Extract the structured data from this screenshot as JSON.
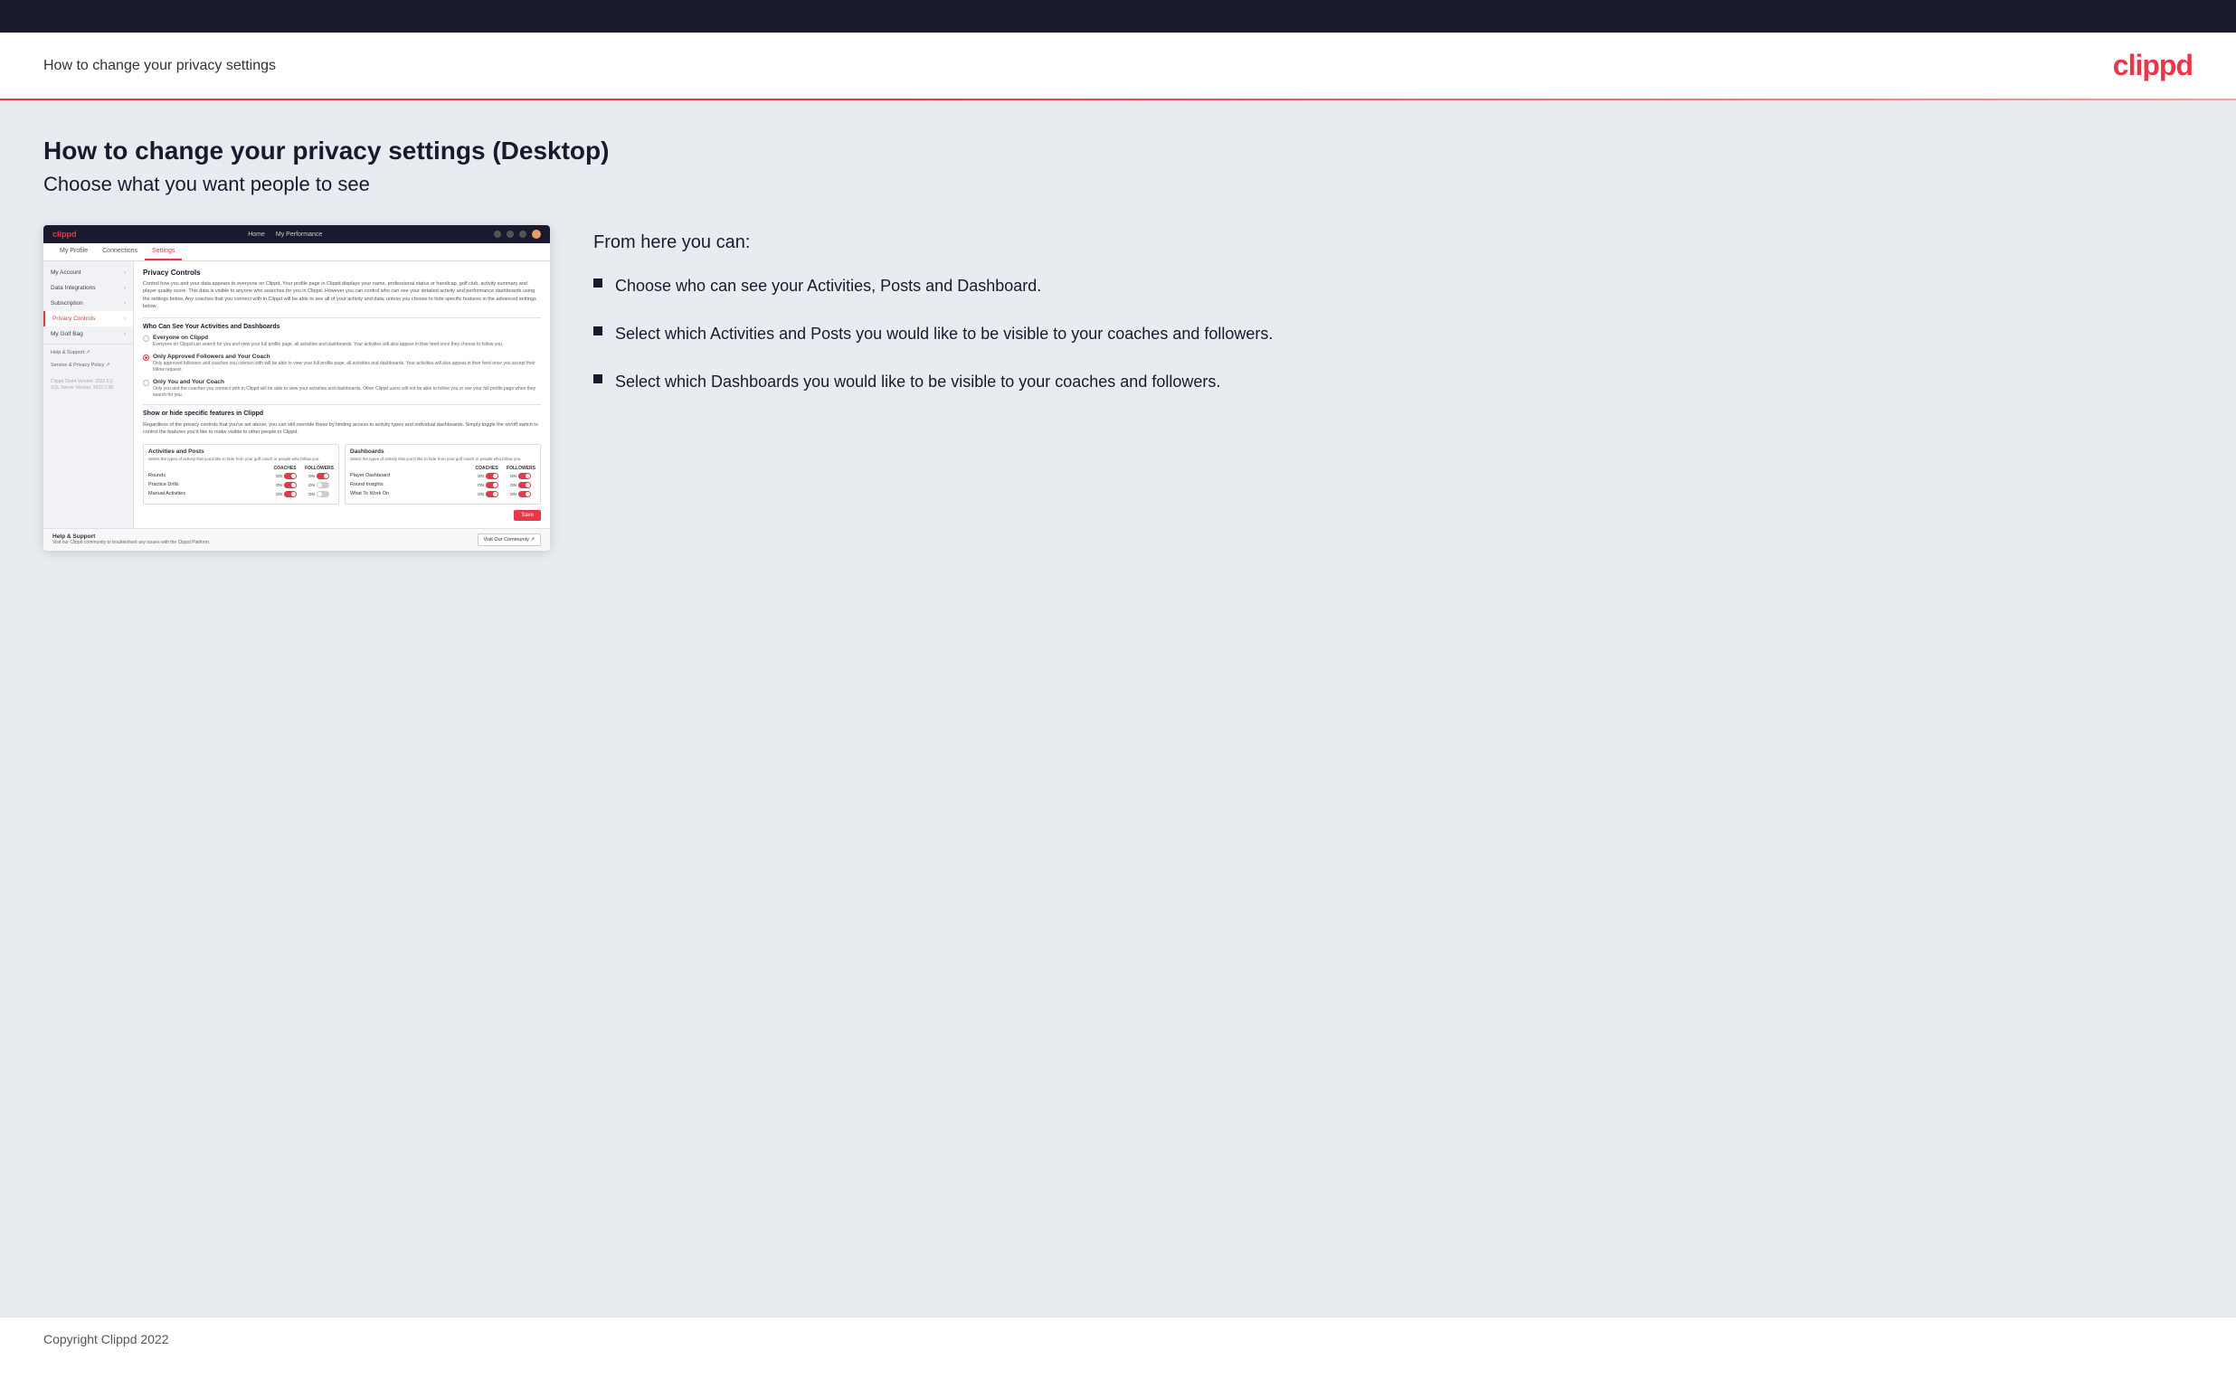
{
  "header": {
    "title": "How to change your privacy settings",
    "logo": "clippd"
  },
  "main": {
    "title": "How to change your privacy settings (Desktop)",
    "subtitle": "Choose what you want people to see",
    "right_col_title": "From here you can:",
    "bullets": [
      {
        "text": "Choose who can see your Activities, Posts and Dashboard."
      },
      {
        "text": "Select which Activities and Posts you would like to be visible to your coaches and followers."
      },
      {
        "text": "Select which Dashboards you would like to be visible to your coaches and followers."
      }
    ]
  },
  "mockup": {
    "nav": {
      "logo": "clippd",
      "links": [
        "Home",
        "My Performance"
      ]
    },
    "tabs": [
      "My Profile",
      "Connections",
      "Settings"
    ],
    "active_tab": "Settings",
    "sidebar": {
      "items": [
        {
          "label": "My Account",
          "active": false
        },
        {
          "label": "Data Integrations",
          "active": false
        },
        {
          "label": "Subscription",
          "active": false
        },
        {
          "label": "Privacy Controls",
          "active": true
        },
        {
          "label": "My Golf Bag",
          "active": false
        }
      ],
      "small_items": [
        {
          "label": "Help & Support ↗"
        },
        {
          "label": "Service & Privacy Policy ↗"
        }
      ],
      "version": "Clippd Client Version: 2022.8.2\nSQL Server Version: 2022.7.38"
    },
    "privacy_controls": {
      "section_title": "Privacy Controls",
      "section_desc": "Control how you and your data appears to everyone on Clippd. Your profile page in Clippd displays your name, professional status or handicap, golf club, activity summary and player quality score. This data is visible to anyone who searches for you in Clippd. However you can control who can see your detailed activity and performance dashboards using the settings below. Any coaches that you connect with in Clippd will be able to see all of your activity and data, unless you choose to hide specific features in the advanced settings below.",
      "who_can_see_title": "Who Can See Your Activities and Dashboards",
      "radio_options": [
        {
          "label": "Everyone on Clippd",
          "desc": "Everyone on Clippd can search for you and view your full profile page, all activities and dashboards. Your activities will also appear in their feed once they choose to follow you.",
          "selected": false
        },
        {
          "label": "Only Approved Followers and Your Coach",
          "desc": "Only approved followers and coaches you connect with will be able to view your full profile page, all activities and dashboards. Your activities will also appear in their feed once you accept their follow request.",
          "selected": true
        },
        {
          "label": "Only You and Your Coach",
          "desc": "Only you and the coaches you connect with in Clippd will be able to view your activities and dashboards. Other Clippd users will not be able to follow you or see your full profile page when they search for you.",
          "selected": false
        }
      ],
      "show_hide_title": "Show or hide specific features in Clippd",
      "show_hide_desc": "Regardless of the privacy controls that you've set above, you can still override these by limiting access to activity types and individual dashboards. Simply toggle the on/off switch to control the features you'd like to make visible to other people in Clippd.",
      "activities_title": "Activities and Posts",
      "activities_desc": "Select the types of activity that you'd like to hide from your golf coach or people who follow you.",
      "activities_col_coaches": "COACHES",
      "activities_col_followers": "FOLLOWERS",
      "activities_rows": [
        {
          "label": "Rounds",
          "coaches_on": true,
          "followers_on": true
        },
        {
          "label": "Practice Drills",
          "coaches_on": true,
          "followers_on": false
        },
        {
          "label": "Manual Activities",
          "coaches_on": true,
          "followers_on": false
        }
      ],
      "dashboards_title": "Dashboards",
      "dashboards_desc": "Select the types of activity that you'd like to hide from your golf coach or people who follow you.",
      "dashboards_col_coaches": "COACHES",
      "dashboards_col_followers": "FOLLOWERS",
      "dashboards_rows": [
        {
          "label": "Player Dashboard",
          "coaches_on": true,
          "followers_on": true
        },
        {
          "label": "Round Insights",
          "coaches_on": true,
          "followers_on": true
        },
        {
          "label": "What To Work On",
          "coaches_on": true,
          "followers_on": true
        }
      ],
      "save_label": "Save",
      "help_title": "Help & Support",
      "help_desc": "Visit our Clippd community to troubleshoot any issues with the Clippd Platform.",
      "help_btn": "Visit Our Community ↗"
    }
  },
  "footer": {
    "copyright": "Copyright Clippd 2022"
  }
}
